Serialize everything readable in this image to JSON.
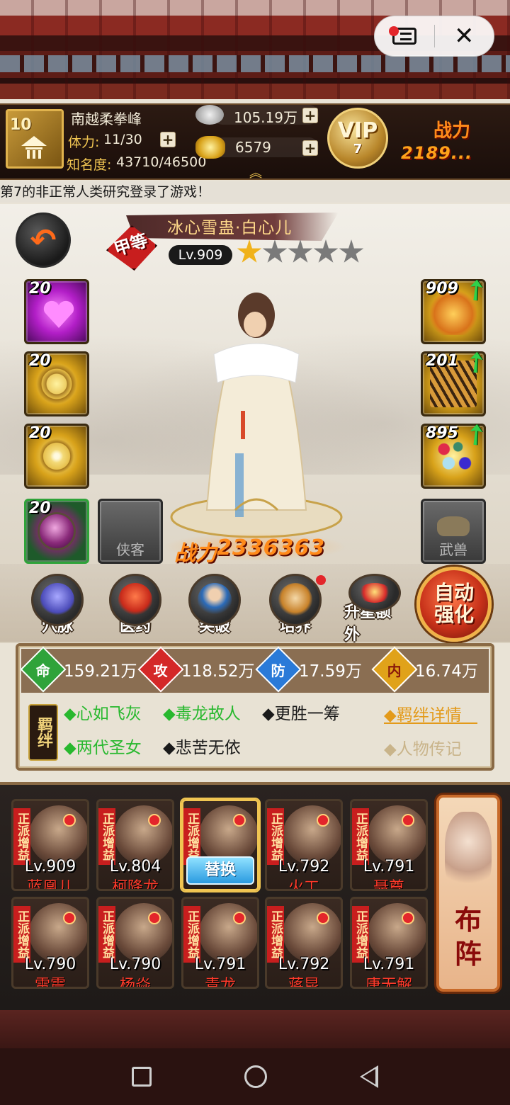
{
  "system": {
    "menu_icon": "mini-program-menu-icon",
    "close_icon": "close-icon"
  },
  "player": {
    "level": "10",
    "name": "南越柔拳峰",
    "stamina_label": "体力:",
    "stamina_value": "11/30",
    "fame_label": "知名度:",
    "fame_value": "43710/46500",
    "silver": "105.19万",
    "gold": "6579",
    "vip_label": "VIP",
    "vip_level": "7",
    "power_label": "战力",
    "power_value": "2189..."
  },
  "marquee": "第7的非正常人类研究登录了游戏！",
  "hero": {
    "name": "冰心雪蛊·白心儿",
    "grade": "甲等",
    "level": "Lv.909",
    "stars_total": 5,
    "stars_filled": 1,
    "power_label": "战力",
    "power_value": "2336363",
    "left_slots": [
      {
        "level": "20",
        "icon": "heart-skill-icon"
      },
      {
        "level": "20",
        "icon": "swirl-skill-icon"
      },
      {
        "level": "20",
        "icon": "orbit-skill-icon"
      },
      {
        "level": "20",
        "icon": "purple-orb-equip-icon"
      }
    ],
    "right_slots": [
      {
        "level": "909",
        "icon": "golden-bird-equip-icon"
      },
      {
        "level": "201",
        "icon": "tiger-equip-icon"
      },
      {
        "level": "895",
        "icon": "gems-equip-icon"
      }
    ],
    "empty_left": "侠客",
    "empty_right": "武兽"
  },
  "actions": [
    {
      "label": "穴脉",
      "icon": "meridian-icon"
    },
    {
      "label": "医药",
      "icon": "medicine-icon"
    },
    {
      "label": "突破",
      "icon": "breakthrough-icon"
    },
    {
      "label": "培养",
      "icon": "training-scroll-icon"
    },
    {
      "label": "升星额外",
      "icon": "star-up-icon"
    }
  ],
  "auto_enhance": {
    "line1": "自动",
    "line2": "强化"
  },
  "stats": [
    {
      "label": "命",
      "value": "159.21万",
      "color": "#2fa33a"
    },
    {
      "label": "攻",
      "value": "118.52万",
      "color": "#d42828"
    },
    {
      "label": "防",
      "value": "17.59万",
      "color": "#2a7ad8"
    },
    {
      "label": "内",
      "value": "16.74万",
      "color": "#e0a21a"
    }
  ],
  "bonds": {
    "seal": "羁绊",
    "row1": [
      "◆心如飞灰",
      "◆毒龙故人",
      "◆更胜一筹"
    ],
    "row2": [
      "◆两代圣女",
      "◆悲苦无依"
    ],
    "detail_link": "◆羁绊详情",
    "bio_link": "◆人物传记"
  },
  "roster": [
    {
      "level": "Lv.909",
      "name": "蓝凰儿",
      "faction": "正派增益"
    },
    {
      "level": "Lv.804",
      "name": "柯降龙",
      "faction": "正派增益"
    },
    {
      "level": "",
      "name": "",
      "faction": "正派增益",
      "swap": "替换"
    },
    {
      "level": "Lv.792",
      "name": "火工",
      "faction": "正派增益"
    },
    {
      "level": "Lv.791",
      "name": "聂尊",
      "faction": "正派增益"
    },
    {
      "level": "Lv.790",
      "name": "雷震",
      "faction": "正派增益"
    },
    {
      "level": "Lv.790",
      "name": "杨焱",
      "faction": "正派增益"
    },
    {
      "level": "Lv.791",
      "name": "青龙",
      "faction": "正派增益"
    },
    {
      "level": "Lv.792",
      "name": "蒋昆",
      "faction": "正派增益"
    },
    {
      "level": "Lv.791",
      "name": "唐无解",
      "faction": "正派增益"
    }
  ],
  "formation": "布阵",
  "nav": [
    "recent-apps-icon",
    "home-icon",
    "back-icon"
  ]
}
